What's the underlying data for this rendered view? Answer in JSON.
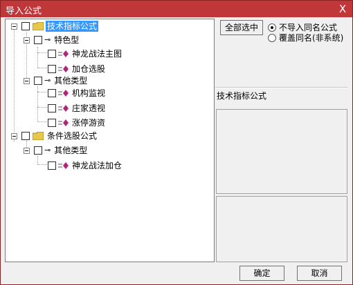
{
  "window": {
    "title": "导入公式",
    "close_glyph": "X"
  },
  "tree": {
    "root1": {
      "label": "技术指标公式"
    },
    "group1": {
      "label": "特色型"
    },
    "g1_items": [
      "神龙战法主图",
      "加仓选股"
    ],
    "group2": {
      "label": "其他类型"
    },
    "g2_items": [
      "机构监视",
      "庄家透视",
      "涨停游资"
    ],
    "root2": {
      "label": "条件选股公式"
    },
    "group3": {
      "label": "其他类型"
    },
    "g3_items": [
      "神龙战法加仓"
    ]
  },
  "options": {
    "select_all_label": "全部选中",
    "radio_no_import": "不导入同名公式",
    "radio_overwrite": "覆盖同名(非系统)",
    "selected_radio": "no_import"
  },
  "info": {
    "section_label": "技术指标公式"
  },
  "footer": {
    "ok_label": "确定",
    "cancel_label": "取消"
  },
  "colors": {
    "titlebar": "#c0373a",
    "selection": "#3399ff",
    "folder": "#e8c84a",
    "diamond": "#b4237a"
  }
}
